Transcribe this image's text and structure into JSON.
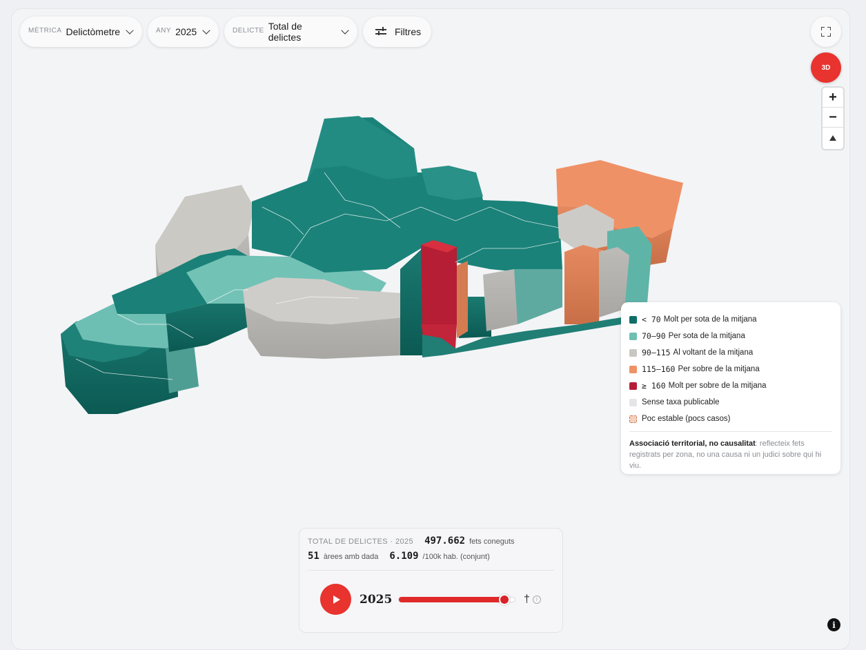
{
  "toolbar": {
    "metric": {
      "label": "Mètrica",
      "value": "Delictòmetre"
    },
    "year": {
      "label": "Any",
      "value": "2025"
    },
    "crime": {
      "label": "Delicte",
      "value": "Total de delictes"
    },
    "filters_label": "Filtres",
    "btn_3d_label": "3D"
  },
  "zoom": {
    "in": "+",
    "out": "−"
  },
  "colors": {
    "very_low": "#0f6e66",
    "low": "#6ebfb3",
    "average": "#c9c7c2",
    "high": "#ef9166",
    "very_high": "#b51e35",
    "no_data": "#e5e5e7",
    "unstable": "#f6d0bf"
  },
  "legend": {
    "items": [
      {
        "range": "< 70",
        "label": "Molt per sota de la mitjana"
      },
      {
        "range": "70–90",
        "label": "Per sota de la mitjana"
      },
      {
        "range": "90–115",
        "label": "Al voltant de la mitjana"
      },
      {
        "range": "115–160",
        "label": "Per sobre de la mitjana"
      },
      {
        "range": "≥ 160",
        "label": "Molt per sobre de la mitjana"
      },
      {
        "range": "",
        "label": "Sense taxa publicable"
      },
      {
        "range": "",
        "label": "Poc estable (pocs casos)"
      }
    ],
    "note_bold": "Associació territorial, no causalitat",
    "note_text": ": reflecteix fets registrats per zona, no una causa ni un judici sobre qui hi viu."
  },
  "stats": {
    "caption": "Total de delictes · 2025",
    "total_facts": "497.662",
    "total_facts_label": "fets coneguts",
    "areas": "51",
    "areas_label": "àrees amb dada",
    "rate": "6.109",
    "rate_label": "/100k hab. (conjunt)"
  },
  "timeline": {
    "year": "2025",
    "progress": 0.91,
    "dagger": "†",
    "info": "i"
  },
  "info_button": "i"
}
